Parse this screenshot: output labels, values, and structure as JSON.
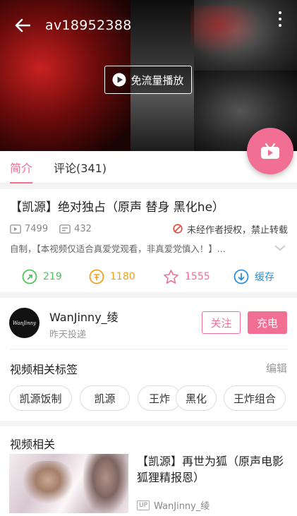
{
  "header": {
    "title": "av18952388",
    "free_play_label": "免流量播放"
  },
  "tabs": [
    {
      "label": "简介",
      "active": true
    },
    {
      "label": "评论(341)",
      "active": false
    }
  ],
  "video": {
    "title": "【凯源】绝对独占（原声 替身 黑化he）",
    "play_count": "7499",
    "danmaku_count": "432",
    "notice": "未经作者授权，禁止转载",
    "description": "自制，【本视频仅适合真爱党观看，非真爱党慎入！】..."
  },
  "actions": {
    "like": "219",
    "coin": "1180",
    "favorite": "1555",
    "cache": "缓存"
  },
  "uploader": {
    "avatar_text": "WanJinny",
    "name": "WanJinny_绫",
    "time": "昨天投递",
    "follow_label": "关注",
    "charge_label": "充电"
  },
  "tags": {
    "heading": "视频相关标签",
    "edit_label": "编辑",
    "items": [
      "凯源饭制",
      "凯源",
      "王炸",
      "黑化",
      "王炸组合"
    ]
  },
  "related": {
    "heading": "视频相关",
    "items": [
      {
        "title": "【凯源】再世为狐（原声电影 狐狸精报恩）",
        "badge": "UP",
        "uploader": "WanJinny_绫"
      }
    ]
  },
  "colors": {
    "accent": "#f06f93",
    "like": "#53c25a",
    "coin": "#f0a11c",
    "favorite": "#f06f93",
    "cache": "#2f8fd8"
  }
}
